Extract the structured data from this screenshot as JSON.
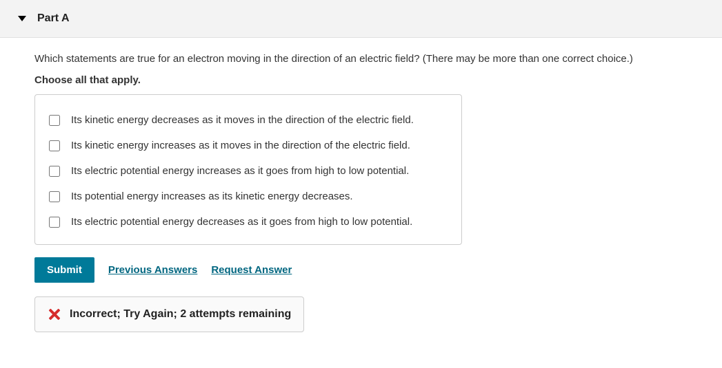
{
  "header": {
    "title": "Part A"
  },
  "question": {
    "text": "Which statements are true for an electron moving in the direction of an electric field? (There may be more than one correct choice.)",
    "instruction": "Choose all that apply.",
    "options": [
      "Its kinetic energy decreases as it moves in the direction of the electric field.",
      "Its kinetic energy increases as it moves in the direction of the electric field.",
      "Its electric potential energy increases as it goes from high to low potential.",
      "Its potential energy increases as its kinetic energy decreases.",
      "Its electric potential energy decreases as it goes from high to low potential."
    ]
  },
  "actions": {
    "submit": "Submit",
    "previous": "Previous Answers",
    "request": "Request Answer"
  },
  "feedback": {
    "message": "Incorrect; Try Again; 2 attempts remaining"
  }
}
